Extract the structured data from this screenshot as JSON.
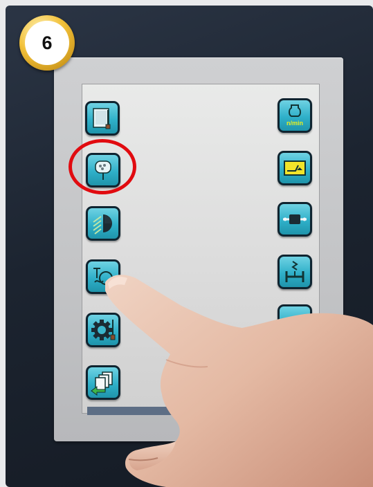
{
  "step_badge": {
    "number": "6"
  },
  "left_buttons": [
    {
      "icon": "display-brightness-icon"
    },
    {
      "icon": "work-light-icon",
      "highlighted": true
    },
    {
      "icon": "headlight-icon"
    },
    {
      "icon": "temperature-fan-icon"
    },
    {
      "icon": "settings-gear-icon"
    },
    {
      "icon": "pages-back-icon"
    }
  ],
  "right_buttons": [
    {
      "icon": "engine-rpm-icon",
      "label": "n/min"
    },
    {
      "icon": "speed-lever-icon"
    },
    {
      "icon": "power-take-off-icon"
    },
    {
      "icon": "axle-suspension-icon"
    },
    {
      "icon": "partially-hidden-icon"
    }
  ],
  "colors": {
    "button_fill": "#2fb0c9",
    "highlight_ring": "#e10b10",
    "badge_gold": "#f2c13a"
  }
}
